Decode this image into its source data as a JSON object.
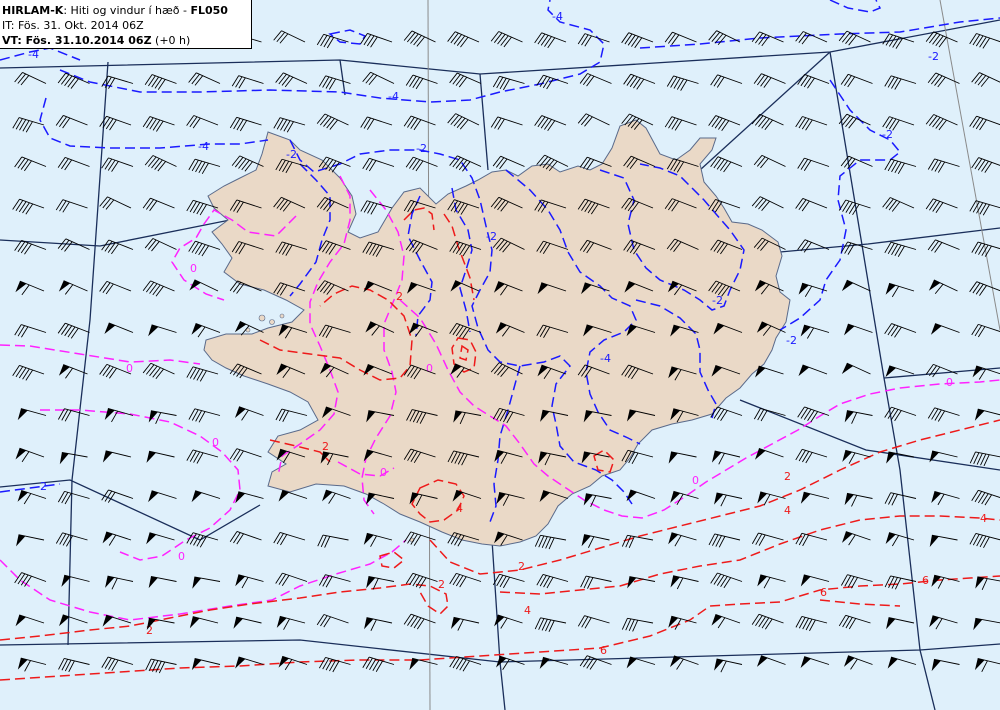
{
  "header": {
    "model": "HIRLAM-K",
    "product": ": Hiti og vindur í hæð - ",
    "level": "FL050",
    "it_label": "IT: ",
    "it_value": "Fös. 31. Okt. 2014 06Z",
    "vt_label": "VT: ",
    "vt_value": "Fös. 31.10.2014 06Z",
    "lead": " (+0 h)"
  },
  "colors": {
    "sea": "#dff0fb",
    "land": "#ead9c7",
    "coast": "#5a6a8a",
    "grid": "#1a2e5a",
    "negative_contour": "#1a1aff",
    "zero_contour": "#ff22ff",
    "positive_contour": "#ff1a1a",
    "wind_barb": "#000000"
  },
  "contour_labels": {
    "blue": [
      "-4",
      "-2",
      "-4",
      "-2",
      "-2",
      "-4",
      "-2",
      "-4",
      "-4",
      "-2",
      "-2",
      "-2",
      "-2"
    ],
    "magenta": [
      "0",
      "0",
      "0",
      "0",
      "0",
      "0",
      "0",
      "0"
    ],
    "red": [
      "2",
      "2",
      "4",
      "2",
      "2",
      "4",
      "6",
      "2",
      "4",
      "6",
      "6",
      "4",
      "2"
    ]
  },
  "wind_barbs": {
    "type": "wind barbs",
    "direction": "mostly north-westerly",
    "grid_rows": 16,
    "grid_cols": 23
  }
}
